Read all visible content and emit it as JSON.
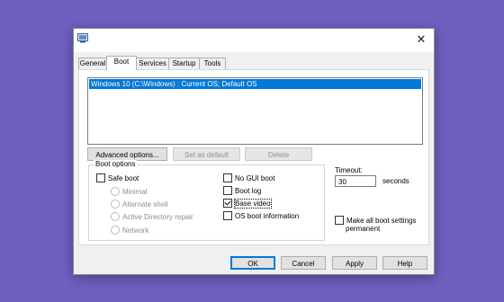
{
  "dialog": {
    "close_glyph": "✕"
  },
  "tabs": [
    {
      "label": "General",
      "active": false
    },
    {
      "label": "Boot",
      "active": true
    },
    {
      "label": "Services",
      "active": false
    },
    {
      "label": "Startup",
      "active": false
    },
    {
      "label": "Tools",
      "active": false
    }
  ],
  "boot_list": {
    "items": [
      "Windows 10 (C:\\Windows) : Current OS; Default OS"
    ]
  },
  "list_buttons": {
    "advanced": "Advanced options...",
    "set_default": "Set as default",
    "delete": "Delete"
  },
  "boot_options": {
    "title": "Boot options",
    "safe_boot": "Safe boot",
    "minimal": "Minimal",
    "alternate_shell": "Alternate shell",
    "ad_repair": "Active Directory repair",
    "network": "Network",
    "no_gui": "No GUI boot",
    "boot_log": "Boot log",
    "base_video": "Base video",
    "os_boot_info": "OS boot information"
  },
  "timeout": {
    "label": "Timeout:",
    "value": "30",
    "unit": "seconds"
  },
  "permanent": {
    "line1": "Make all boot settings",
    "line2": "permanent"
  },
  "footer": {
    "ok": "OK",
    "cancel": "Cancel",
    "apply": "Apply",
    "help": "Help"
  },
  "colors": {
    "selection": "#0078d7",
    "background": "#6f5fc0"
  }
}
